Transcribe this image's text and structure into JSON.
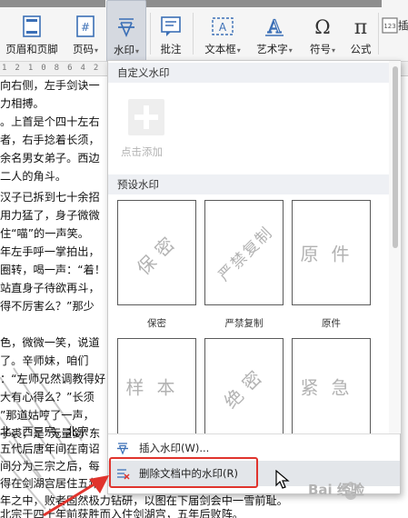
{
  "ribbon": {
    "items": [
      {
        "label": "页眉和页脚",
        "caret": ""
      },
      {
        "label": "页码",
        "caret": "▾"
      },
      {
        "label": "水印",
        "caret": "▾"
      },
      {
        "label": "批注",
        "caret": ""
      },
      {
        "label": "文本框",
        "caret": "▾"
      },
      {
        "label": "艺术字",
        "caret": "▾"
      },
      {
        "label": "符号",
        "caret": "▾"
      },
      {
        "label": "公式",
        "caret": ""
      }
    ],
    "overflow_label": "插",
    "active_item": "水印"
  },
  "ruler": {
    "numbers": "121086422468101214161820"
  },
  "document": {
    "lines": [
      "向右侧，左手剑诀一",
      "力相搏。",
      "。上首是个四十左右",
      "者，右手捻着长须，",
      "余名男女弟子。西边",
      "二人的角斗。",
      "汉子已拆到七十余招",
      "用力猛了，身子微微",
      "住“喵”的一声笑。",
      "年左手呼一掌拍出，",
      "圈转，喝一声：“着！",
      "站直身子待欲再斗，",
      "得不厉害么？”那少",
      "",
      "色，微微一笑，说道",
      "了。辛师妹，咱们",
      "：“左师兄然调教得好",
      "大有心得么？”长须",
      "”那道姑哼了一声，",
      "子裘，是“无量剑”东",
      "",
      "北、西三宗，北宗",
      "五代后唐年间在南诏",
      "间分为三宗之后，每",
      "得在剑湖宫居住五年",
      "年之中，败者固然极力钻研，以图在下届剑会中一雪前耻。",
      "北宗于四十年前获胜而入住剑湖宫，五年后败阵。"
    ]
  },
  "panel": {
    "custom_title": "自定义水印",
    "add_label": "点击添加",
    "preset_title": "预设水印",
    "presets": [
      {
        "text": "保密",
        "caption": "保密"
      },
      {
        "text": "严禁复制",
        "caption": "严禁复制"
      },
      {
        "text": "原件",
        "caption": "原件"
      },
      {
        "text": "样本",
        "caption": ""
      },
      {
        "text": "绝密",
        "caption": ""
      },
      {
        "text": "紧急",
        "caption": ""
      }
    ],
    "insert_label": "插入水印(W)...",
    "delete_label": "删除文档中的水印(R)"
  },
  "watermark_site": "Bai 经验",
  "colors": {
    "highlight_border": "#e0342d",
    "accent_blue": "#3b6fb6"
  }
}
